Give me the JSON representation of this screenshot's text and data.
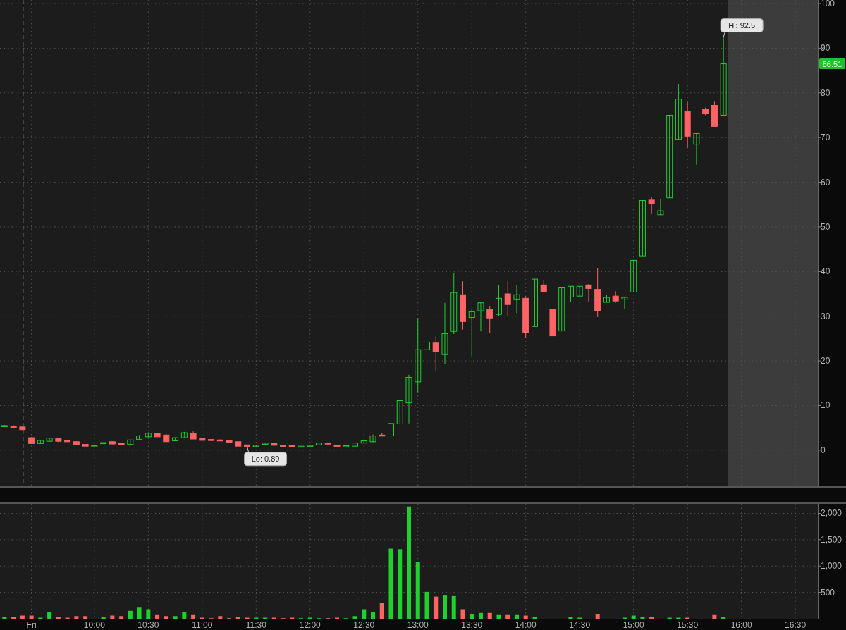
{
  "price_chart": {
    "chart_data": {
      "type": "candlestick",
      "grid": true,
      "ylim": [
        -8.07,
        100.79
      ],
      "yticks": [
        100,
        90,
        80,
        70,
        60,
        50,
        40,
        30,
        20,
        10,
        0
      ],
      "categories": [
        null,
        null,
        null,
        null,
        null,
        null,
        null,
        null,
        null,
        null,
        null,
        null,
        null,
        null,
        null,
        null,
        null,
        null,
        null,
        null,
        null,
        null,
        null,
        null,
        null,
        null,
        null,
        null,
        null,
        null,
        null,
        null,
        null,
        null,
        null,
        null,
        null,
        null,
        null,
        null,
        null,
        null,
        null,
        null,
        null,
        null,
        null,
        null,
        null,
        null,
        null,
        null,
        null,
        null,
        null,
        null,
        null,
        null,
        null,
        null,
        null,
        null,
        null,
        null,
        null,
        null,
        null,
        null,
        null,
        null,
        null,
        null,
        null,
        null,
        null,
        null,
        null,
        null,
        null,
        null,
        null,
        null,
        null,
        null,
        null,
        null,
        null,
        null,
        null,
        null,
        null
      ],
      "ohlc": [
        [
          5.3,
          5.6,
          5.2,
          5.5
        ],
        [
          5.3,
          5.6,
          5.0,
          5.2
        ],
        [
          5.2,
          5.3,
          4.6,
          4.6
        ],
        [
          2.8,
          2.9,
          1.5,
          1.5
        ],
        [
          1.5,
          2.3,
          1.5,
          2.2
        ],
        [
          2.0,
          2.8,
          2.0,
          2.7
        ],
        [
          2.6,
          2.6,
          1.8,
          2.0
        ],
        [
          2.2,
          2.3,
          1.9,
          1.9
        ],
        [
          1.9,
          2.0,
          1.3,
          1.3
        ],
        [
          1.3,
          1.3,
          0.9,
          0.9
        ],
        [
          0.9,
          1.1,
          0.9,
          1.0
        ],
        [
          1.5,
          1.7,
          1.5,
          1.7
        ],
        [
          1.9,
          2.0,
          1.3,
          1.4
        ],
        [
          1.6,
          1.7,
          1.2,
          1.3
        ],
        [
          1.3,
          2.3,
          1.3,
          2.3
        ],
        [
          2.4,
          3.4,
          2.4,
          3.2
        ],
        [
          3.0,
          4.0,
          2.9,
          3.8
        ],
        [
          3.8,
          3.9,
          3.0,
          3.0
        ],
        [
          3.4,
          3.5,
          1.9,
          1.9
        ],
        [
          2.1,
          2.8,
          2.1,
          2.8
        ],
        [
          2.8,
          4.1,
          2.7,
          3.9
        ],
        [
          3.7,
          4.2,
          2.5,
          2.5
        ],
        [
          2.6,
          2.7,
          2.1,
          2.2
        ],
        [
          2.4,
          2.5,
          2.2,
          2.2
        ],
        [
          2.3,
          2.4,
          2.1,
          2.1
        ],
        [
          2.1,
          2.1,
          1.8,
          1.8
        ],
        [
          1.9,
          1.9,
          0.9,
          0.9
        ],
        [
          1.2,
          1.2,
          0.8,
          0.8
        ],
        [
          0.8,
          1.1,
          0.8,
          1.1
        ],
        [
          1.3,
          1.6,
          1.3,
          1.6
        ],
        [
          1.6,
          1.7,
          1.1,
          1.1
        ],
        [
          1.1,
          1.1,
          1.0,
          1.0
        ],
        [
          1.0,
          1.0,
          0.9,
          0.9
        ],
        [
          0.8,
          0.9,
          0.8,
          0.9
        ],
        [
          1.0,
          1.1,
          1.0,
          1.1
        ],
        [
          1.2,
          1.6,
          1.2,
          1.6
        ],
        [
          1.6,
          1.6,
          1.4,
          1.4
        ],
        [
          1.1,
          1.1,
          0.9,
          0.9
        ],
        [
          1.0,
          1.0,
          1.0,
          1.0
        ],
        [
          0.9,
          1.6,
          0.9,
          1.6
        ],
        [
          1.6,
          2.4,
          1.6,
          2.1
        ],
        [
          1.9,
          3.5,
          1.8,
          3.2
        ],
        [
          3.4,
          3.8,
          3.2,
          3.2
        ],
        [
          3.2,
          6.0,
          3.0,
          6.0
        ],
        [
          5.9,
          11.1,
          5.9,
          11.1
        ],
        [
          10.6,
          16.9,
          6.0,
          16.3
        ],
        [
          15.3,
          29.6,
          13.0,
          22.5
        ],
        [
          22.5,
          26.9,
          16.4,
          24.2
        ],
        [
          24.0,
          25.5,
          17.6,
          22.0
        ],
        [
          21.4,
          33.0,
          19.3,
          26.1
        ],
        [
          26.6,
          39.6,
          26.0,
          35.3
        ],
        [
          34.8,
          37.8,
          27.0,
          28.8
        ],
        [
          29.7,
          31.5,
          21.0,
          31.0
        ],
        [
          31.2,
          33.0,
          26.6,
          33.0
        ],
        [
          31.5,
          32.3,
          26.2,
          29.6
        ],
        [
          30.4,
          37.0,
          30.0,
          34.0
        ],
        [
          35.0,
          37.8,
          30.0,
          32.6
        ],
        [
          33.7,
          37.0,
          30.7,
          34.8
        ],
        [
          34.0,
          34.5,
          25.2,
          26.4
        ],
        [
          27.7,
          38.3,
          27.7,
          38.3
        ],
        [
          37.0,
          38.0,
          35.4,
          35.4
        ],
        [
          31.5,
          31.5,
          25.6,
          25.6
        ],
        [
          26.7,
          36.5,
          26.7,
          36.5
        ],
        [
          34.3,
          36.7,
          33.2,
          36.7
        ],
        [
          34.5,
          36.7,
          34.5,
          36.7
        ],
        [
          37.0,
          37.2,
          33.2,
          36.2
        ],
        [
          36.0,
          40.7,
          29.8,
          31.2
        ],
        [
          33.1,
          34.8,
          33.1,
          34.2
        ],
        [
          34.5,
          35.6,
          33.0,
          33.4
        ],
        [
          33.8,
          34.2,
          31.6,
          34.2
        ],
        [
          35.4,
          42.5,
          35.4,
          42.5
        ],
        [
          43.5,
          55.9,
          43.5,
          55.9
        ],
        [
          56.0,
          56.7,
          53.0,
          55.2
        ],
        [
          52.7,
          56.2,
          52.7,
          53.6
        ],
        [
          56.5,
          75.0,
          56.5,
          75.0
        ],
        [
          69.6,
          82.0,
          69.6,
          78.6
        ],
        [
          75.8,
          78.0,
          67.7,
          70.3
        ],
        [
          68.5,
          70.9,
          63.9,
          70.9
        ],
        [
          76.3,
          76.7,
          75.0,
          75.3
        ],
        [
          77.2,
          78.0,
          72.5,
          72.5
        ],
        [
          75.0,
          92.5,
          75.0,
          86.5
        ],
        null,
        null,
        null,
        null,
        null,
        null,
        null,
        null,
        null,
        null
      ]
    },
    "callouts": [
      {
        "kind": "high",
        "text": "Hi: 92.5"
      },
      {
        "kind": "low",
        "text": "Lo: 0.89"
      }
    ],
    "last_price_tag": "86.51"
  },
  "volume_chart": {
    "chart_data": {
      "type": "bar",
      "grid": true,
      "ylim": [
        0,
        2180
      ],
      "categories": [
        null,
        null,
        null,
        "Fri",
        null,
        null,
        null,
        null,
        null,
        null,
        "10:00",
        null,
        null,
        null,
        null,
        null,
        "10:30",
        null,
        null,
        null,
        null,
        null,
        "11:00",
        null,
        null,
        null,
        null,
        null,
        "11:30",
        null,
        null,
        null,
        null,
        null,
        "12:00",
        null,
        null,
        null,
        null,
        null,
        "12:30",
        null,
        null,
        null,
        null,
        null,
        "13:00",
        null,
        null,
        null,
        null,
        null,
        "13:30",
        null,
        null,
        null,
        null,
        null,
        "14:00",
        null,
        null,
        null,
        null,
        null,
        "14:30",
        null,
        null,
        null,
        null,
        null,
        "15:00",
        null,
        null,
        null,
        null,
        null,
        "15:30",
        null,
        null,
        null,
        null,
        null,
        "16:00",
        null,
        null,
        null,
        null,
        null,
        "16:30",
        null,
        null
      ],
      "yticks": [
        {
          "value": 2000,
          "label": "2,000"
        },
        {
          "value": 1500,
          "label": "1,500"
        },
        {
          "value": 1000,
          "label": "1,000"
        },
        {
          "value": 500,
          "label": "500"
        }
      ],
      "series": [
        {
          "color": "#1ed22e",
          "values": [
            40,
            null,
            null,
            null,
            20,
            130,
            null,
            null,
            null,
            null,
            0,
            30,
            null,
            null,
            150,
            210,
            180,
            null,
            null,
            50,
            130,
            null,
            null,
            null,
            null,
            null,
            null,
            null,
            20,
            20,
            null,
            null,
            null,
            10,
            20,
            10,
            null,
            null,
            10,
            50,
            180,
            120,
            null,
            1330,
            1320,
            2130,
            1070,
            510,
            null,
            440,
            430,
            null,
            80,
            110,
            null,
            70,
            null,
            70,
            null,
            30,
            0,
            0,
            0,
            30,
            20,
            0,
            null,
            0,
            0,
            20,
            60,
            40,
            null,
            0,
            20,
            20,
            null,
            0,
            0,
            null,
            30,
            null,
            null,
            null,
            null,
            null,
            null,
            null,
            null,
            null,
            null
          ]
        },
        {
          "color": "#ff6363",
          "values": [
            null,
            30,
            60,
            60,
            null,
            null,
            30,
            20,
            50,
            50,
            null,
            null,
            60,
            50,
            null,
            null,
            null,
            70,
            50,
            null,
            null,
            70,
            20,
            10,
            50,
            10,
            40,
            20,
            null,
            null,
            20,
            10,
            20,
            null,
            null,
            null,
            10,
            20,
            null,
            null,
            null,
            null,
            300,
            null,
            null,
            null,
            null,
            null,
            420,
            null,
            null,
            180,
            null,
            null,
            110,
            null,
            70,
            null,
            60,
            null,
            null,
            null,
            null,
            null,
            null,
            null,
            80,
            null,
            null,
            null,
            null,
            null,
            30,
            null,
            null,
            null,
            20,
            null,
            null,
            70,
            null,
            null,
            null,
            null,
            null,
            null,
            null,
            null,
            null,
            null,
            null
          ]
        }
      ]
    }
  }
}
